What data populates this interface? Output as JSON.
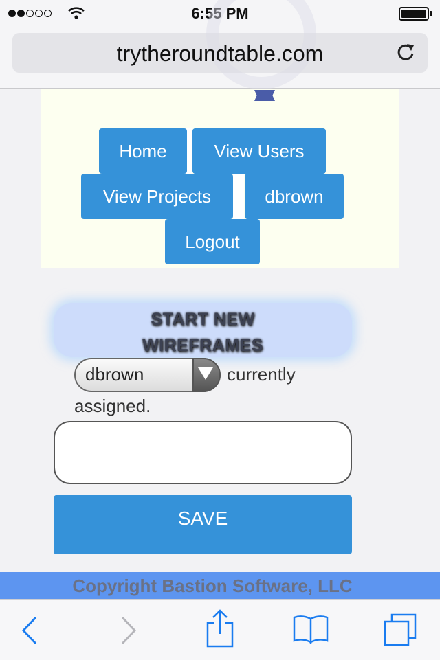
{
  "status_bar": {
    "time": "6:55 PM",
    "signal": "signal-dots-icon",
    "wifi": "wifi-icon",
    "battery": "battery-icon"
  },
  "browser": {
    "url": "trytheroundtable.com",
    "reload_icon": "reload-icon"
  },
  "nav": {
    "items": [
      "Home",
      "View Users",
      "View Projects",
      "dbrown",
      "Logout"
    ]
  },
  "main": {
    "start_button_line1": "START NEW",
    "start_button_line2": "WIREFRAMES",
    "assignee_select_value": "dbrown",
    "assigned_text_1": "currently",
    "assigned_text_2": "assigned.",
    "textbox_value": "",
    "save_label": "SAVE"
  },
  "footer": {
    "copyright": "Copyright Bastion Software, LLC"
  },
  "toolbar": {
    "icons": [
      "back-icon",
      "forward-icon",
      "share-icon",
      "bookmarks-icon",
      "tabs-icon"
    ]
  },
  "colors": {
    "accent": "#3592d9",
    "footer": "#5d95f0",
    "panel": "#fdfff0",
    "start_button": "#cddcfb",
    "ios_blue": "#1a7cf0"
  }
}
